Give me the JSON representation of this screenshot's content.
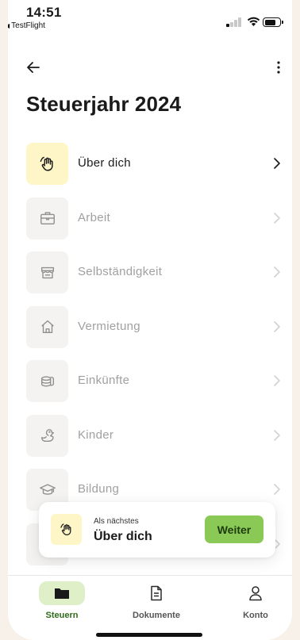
{
  "status_bar": {
    "time": "14:51",
    "back_app": "TestFlight"
  },
  "page": {
    "title": "Steuerjahr 2024"
  },
  "sections": [
    {
      "label": "Über dich",
      "icon": "wave-hand-icon",
      "active": true
    },
    {
      "label": "Arbeit",
      "icon": "briefcase-icon",
      "active": false
    },
    {
      "label": "Selbständigkeit",
      "icon": "store-icon",
      "active": false
    },
    {
      "label": "Vermietung",
      "icon": "house-icon",
      "active": false
    },
    {
      "label": "Einkünfte",
      "icon": "coins-icon",
      "active": false
    },
    {
      "label": "Kinder",
      "icon": "duck-icon",
      "active": false
    },
    {
      "label": "Bildung",
      "icon": "graduation-cap-icon",
      "active": false
    }
  ],
  "next_card": {
    "caption": "Als nächstes",
    "title": "Über dich",
    "button": "Weiter"
  },
  "tabs": [
    {
      "label": "Steuern",
      "icon": "folder-icon",
      "active": true
    },
    {
      "label": "Dokumente",
      "icon": "document-icon",
      "active": false
    },
    {
      "label": "Konto",
      "icon": "person-icon",
      "active": false
    }
  ],
  "colors": {
    "accent_green": "#8bc956",
    "tab_active_bg": "#dff0c8",
    "highlight_yellow": "#fff6c8"
  }
}
